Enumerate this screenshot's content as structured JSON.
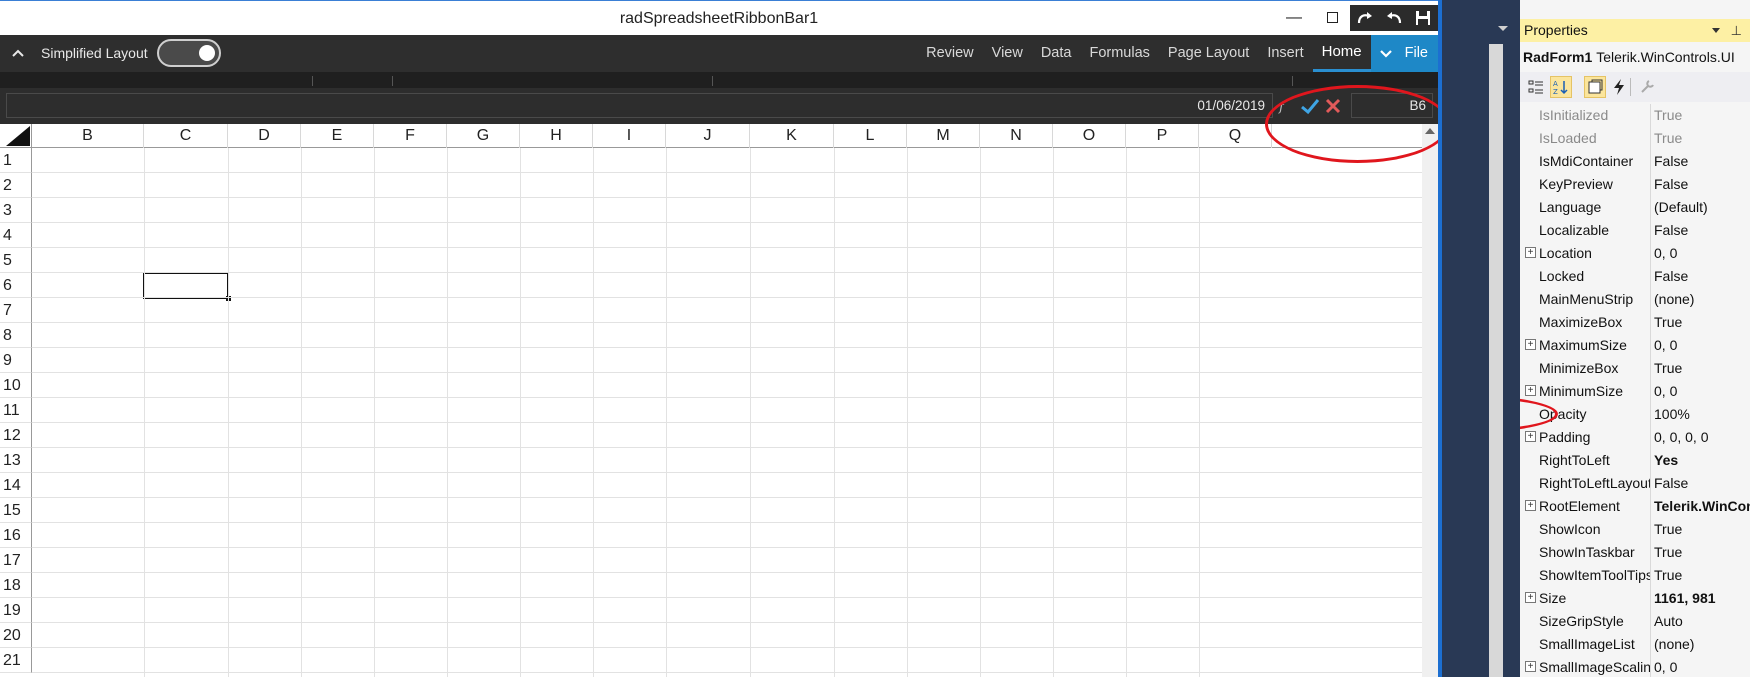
{
  "window": {
    "title": "radSpreadsheetRibbonBar1"
  },
  "ribbon": {
    "simplified_layout_label": "Simplified Layout",
    "simplified_layout_on": true,
    "tabs": [
      "Home",
      "Insert",
      "Page Layout",
      "Formulas",
      "Data",
      "View",
      "Review"
    ],
    "active_tab": "Home",
    "file_label": "File"
  },
  "formula_bar": {
    "value": "01/06/2019",
    "name_box": "B6"
  },
  "sheet": {
    "columns": [
      "B",
      "C",
      "D",
      "E",
      "F",
      "G",
      "H",
      "I",
      "J",
      "K",
      "L",
      "M",
      "N",
      "O",
      "P",
      "Q"
    ],
    "rows": [
      "1",
      "2",
      "3",
      "4",
      "5",
      "6",
      "7",
      "8",
      "9",
      "10",
      "11",
      "12",
      "13",
      "14",
      "15",
      "16",
      "17",
      "18",
      "19",
      "20",
      "21"
    ],
    "selected_cell": "B6"
  },
  "properties": {
    "title": "Properties",
    "object_name": "RadForm1",
    "object_type": "Telerik.WinControls.UI",
    "items": [
      {
        "name": "IsInitialized",
        "value": "True",
        "expandable": false,
        "readonly": true,
        "bold": false
      },
      {
        "name": "IsLoaded",
        "value": "True",
        "expandable": false,
        "readonly": true,
        "bold": false
      },
      {
        "name": "IsMdiContainer",
        "value": "False",
        "expandable": false,
        "readonly": false,
        "bold": false
      },
      {
        "name": "KeyPreview",
        "value": "False",
        "expandable": false,
        "readonly": false,
        "bold": false
      },
      {
        "name": "Language",
        "value": "(Default)",
        "expandable": false,
        "readonly": false,
        "bold": false
      },
      {
        "name": "Localizable",
        "value": "False",
        "expandable": false,
        "readonly": false,
        "bold": false
      },
      {
        "name": "Location",
        "value": "0, 0",
        "expandable": true,
        "readonly": false,
        "bold": false
      },
      {
        "name": "Locked",
        "value": "False",
        "expandable": false,
        "readonly": false,
        "bold": false
      },
      {
        "name": "MainMenuStrip",
        "value": "(none)",
        "expandable": false,
        "readonly": false,
        "bold": false
      },
      {
        "name": "MaximizeBox",
        "value": "True",
        "expandable": false,
        "readonly": false,
        "bold": false
      },
      {
        "name": "MaximumSize",
        "value": "0, 0",
        "expandable": true,
        "readonly": false,
        "bold": false
      },
      {
        "name": "MinimizeBox",
        "value": "True",
        "expandable": false,
        "readonly": false,
        "bold": false
      },
      {
        "name": "MinimumSize",
        "value": "0, 0",
        "expandable": true,
        "readonly": false,
        "bold": false
      },
      {
        "name": "Opacity",
        "value": "100%",
        "expandable": false,
        "readonly": false,
        "bold": false
      },
      {
        "name": "Padding",
        "value": "0, 0, 0, 0",
        "expandable": true,
        "readonly": false,
        "bold": false
      },
      {
        "name": "RightToLeft",
        "value": "Yes",
        "expandable": false,
        "readonly": false,
        "bold": true
      },
      {
        "name": "RightToLeftLayout",
        "value": "False",
        "expandable": false,
        "readonly": false,
        "bold": false
      },
      {
        "name": "RootElement",
        "value": "Telerik.WinControls",
        "expandable": true,
        "readonly": false,
        "bold": true
      },
      {
        "name": "ShowIcon",
        "value": "True",
        "expandable": false,
        "readonly": false,
        "bold": false
      },
      {
        "name": "ShowInTaskbar",
        "value": "True",
        "expandable": false,
        "readonly": false,
        "bold": false
      },
      {
        "name": "ShowItemToolTips",
        "value": "True",
        "expandable": false,
        "readonly": false,
        "bold": false
      },
      {
        "name": "Size",
        "value": "1161, 981",
        "expandable": true,
        "readonly": false,
        "bold": true
      },
      {
        "name": "SizeGripStyle",
        "value": "Auto",
        "expandable": false,
        "readonly": false,
        "bold": false
      },
      {
        "name": "SmallImageList",
        "value": "(none)",
        "expandable": false,
        "readonly": false,
        "bold": false
      },
      {
        "name": "SmallImageScaling",
        "value": "0, 0",
        "expandable": true,
        "readonly": false,
        "bold": false
      }
    ]
  },
  "colors": {
    "ribbon_bg": "#2e2e2e",
    "accent_blue": "#1e88c7",
    "annotation_red": "#e0161d",
    "properties_header": "#fdf0a4"
  },
  "icons": {
    "qat": [
      "redo-icon",
      "undo-icon",
      "save-icon"
    ],
    "formula": [
      "fx-icon",
      "check-icon",
      "close-icon"
    ]
  }
}
